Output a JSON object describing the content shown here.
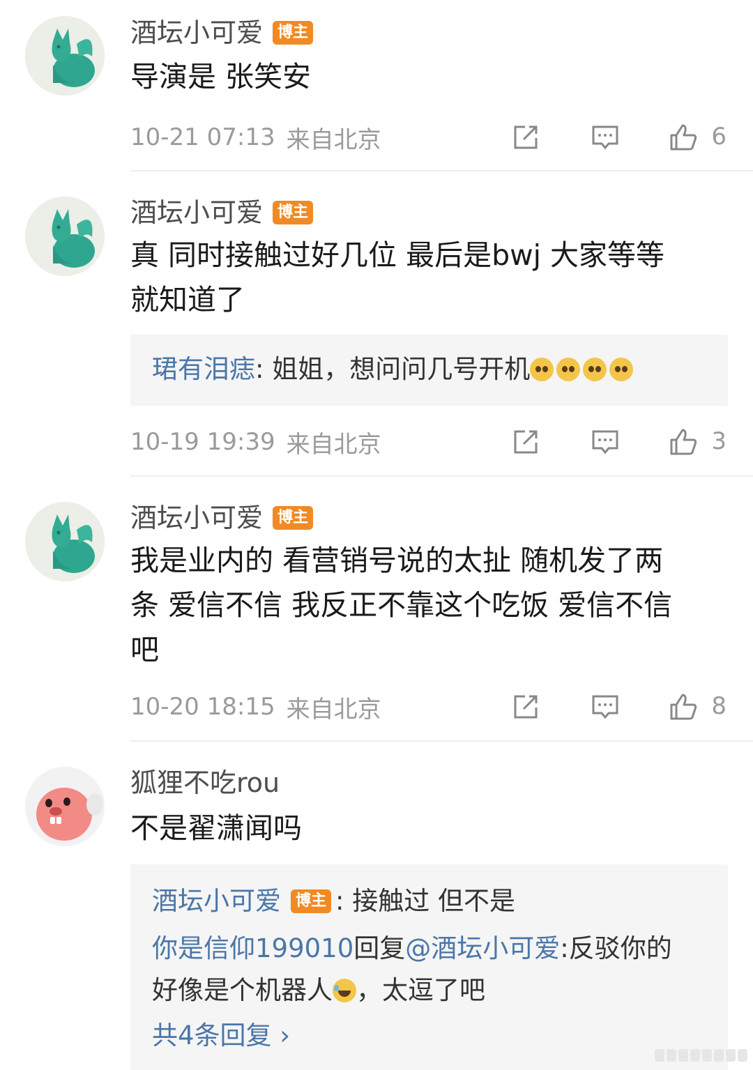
{
  "badge_label": "博主",
  "colors": {
    "link_blue": "#4b76a8",
    "badge_orange": "#f08a24",
    "meta_gray": "#9a9a9a",
    "reply_bg": "#f5f5f5"
  },
  "comments": [
    {
      "avatar": "jade-fox-avatar",
      "author": "酒坛小可爱",
      "is_blogger": true,
      "text": "导演是 张笑安",
      "time": "10-21 07:13",
      "location": "来自北京",
      "likes": "6"
    },
    {
      "avatar": "jade-fox-avatar",
      "author": "酒坛小可爱",
      "is_blogger": true,
      "text_lines": [
        "真 同时接触过好几位 最后是bwj 大家等等",
        "就知道了"
      ],
      "reply": {
        "author": "珺有泪痣",
        "separator": ":",
        "text": " 姐姐，想问问几号开机",
        "emoji": [
          "pleading-face-icon",
          "pleading-face-icon",
          "pleading-face-icon",
          "pleading-face-icon"
        ]
      },
      "time": "10-19 19:39",
      "location": "来自北京",
      "likes": "3"
    },
    {
      "avatar": "jade-fox-avatar",
      "author": "酒坛小可爱",
      "is_blogger": true,
      "text_lines": [
        "我是业内的 看营销号说的太扯 随机发了两",
        "条 爱信不信 我反正不靠这个吃饭  爱信不信",
        "吧"
      ],
      "time": "10-20 18:15",
      "location": "来自北京",
      "likes": "8"
    },
    {
      "avatar": "pink-beaver-avatar",
      "author": "狐狸不吃rou",
      "is_blogger": false,
      "text": "不是翟潇闻吗",
      "replies": [
        {
          "author": "酒坛小可爱",
          "is_blogger": true,
          "text": ": 接触过 但不是"
        },
        {
          "author": "你是信仰199010",
          "mid": "回复",
          "mention": "@酒坛小可爱",
          "text": ":反驳你的",
          "text2": "好像是个机器人",
          "emoji": "laughing-tears-icon",
          "text3": "，太逗了吧"
        }
      ],
      "more_replies": "共4条回复 ›"
    }
  ]
}
